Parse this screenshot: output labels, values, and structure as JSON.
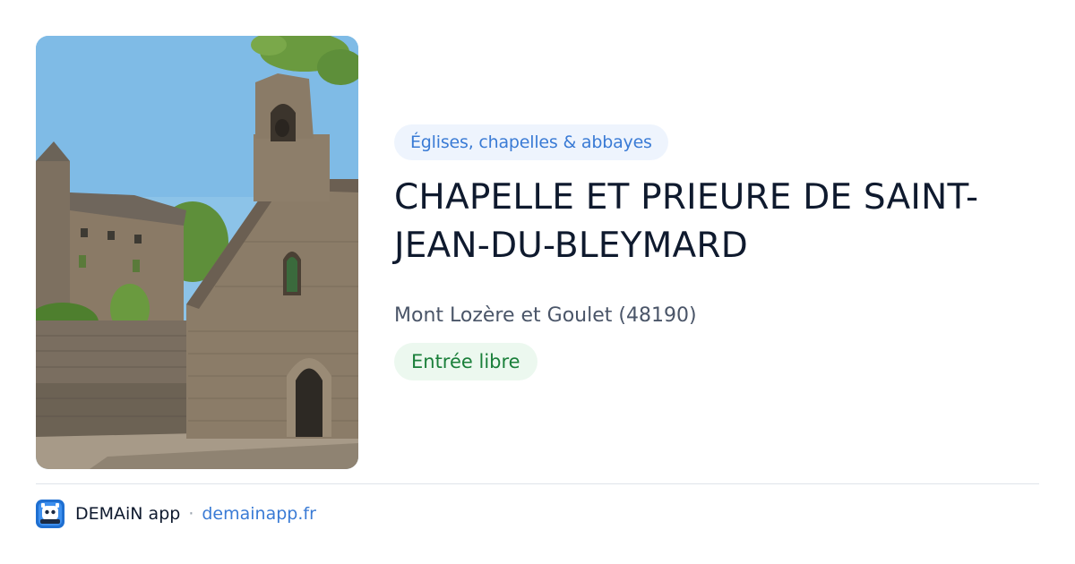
{
  "card": {
    "category": "Églises, chapelles & abbayes",
    "title": "CHAPELLE ET PRIEURE DE SAINT-JEAN-DU-BLEYMARD",
    "location": "Mont Lozère et Goulet (48190)",
    "access": "Entrée libre",
    "photo_icon": "chapel-photo"
  },
  "footer": {
    "app_name": "DEMAiN app",
    "separator": "·",
    "site": "demainapp.fr",
    "app_icon": "demain-app-icon"
  },
  "colors": {
    "category_text": "#3a7bd5",
    "category_bg": "#eef4fd",
    "access_text": "#1a7f3a",
    "access_bg": "#ecf8ef",
    "title_text": "#0f1a2e",
    "link": "#3a7bd5"
  }
}
